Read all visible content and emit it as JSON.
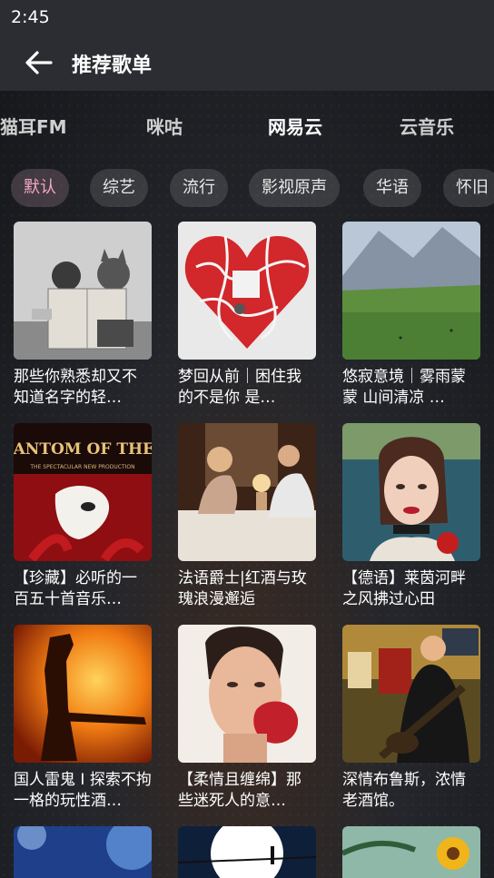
{
  "status": {
    "time": "2:45"
  },
  "appbar": {
    "title": "推荐歌单"
  },
  "tabs": [
    "猫耳FM",
    "咪咕",
    "网易云",
    "云音乐"
  ],
  "chips": [
    "默认",
    "综艺",
    "流行",
    "影视原声",
    "华语",
    "怀旧"
  ],
  "playlists": [
    {
      "title": "那些你熟悉却又不知道名字的轻…"
    },
    {
      "title": "梦回从前｜困住我的不是你 是…"
    },
    {
      "title": "悠寂意境｜雾雨蒙蒙 山间清凉 …"
    },
    {
      "title": "【珍藏】必听的一百五十首音乐…"
    },
    {
      "title": "法语爵士|红酒与玫瑰浪漫邂逅"
    },
    {
      "title": "【德语】莱茵河畔之风拂过心田"
    },
    {
      "title": "国人雷鬼 I 探索不拘一格的玩性酒…"
    },
    {
      "title": "【柔情且缠绵】那些迷死人的意…"
    },
    {
      "title": "深情布鲁斯，浓情老酒馆。"
    }
  ],
  "cover_art": {
    "phantom_title": "THE PHANTOM OF THE OPERA",
    "phantom_sub": "THE SPECTACULAR NEW PRODUCTION"
  },
  "colors": {
    "active_chip": "#f2a9c4",
    "bar": "#2b2d33"
  }
}
